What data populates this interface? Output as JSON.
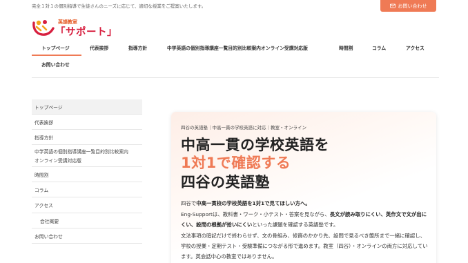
{
  "topbar": {
    "tagline": "完全１対１の個別指導で生徒さんのニーズに応じて、適切な授業をご提案いたします。",
    "contact_button": "お問い合わせ",
    "contact_icon": "mail-icon"
  },
  "logo": {
    "sub": "英語教室",
    "main": "「サポート」",
    "colors": {
      "orange": "#f4a31c",
      "red": "#d71f3f"
    }
  },
  "nav": {
    "items": [
      "トップページ",
      "代表挨拶",
      "指導方針",
      "中学英語の個別指導講座一覧目的別比較案内オンライン受講対応版",
      "時間割",
      "コラム",
      "アクセス",
      "お問い合わせ"
    ],
    "active_index": 0
  },
  "sidebar": {
    "items": [
      {
        "label": "トップページ",
        "active": true,
        "sub": false
      },
      {
        "label": "代表挨拶",
        "active": false,
        "sub": false
      },
      {
        "label": "指導方針",
        "active": false,
        "sub": false
      },
      {
        "label": "中学英語の個別指導講座一覧目的別比較案内",
        "label2": "オンライン受講対応版",
        "active": false,
        "sub": false
      },
      {
        "label": "時間割",
        "active": false,
        "sub": false
      },
      {
        "label": "コラム",
        "active": false,
        "sub": false
      },
      {
        "label": "アクセス",
        "active": false,
        "sub": false
      },
      {
        "label": "会社概要",
        "active": false,
        "sub": true
      },
      {
        "label": "お問い合わせ",
        "active": false,
        "sub": false
      }
    ]
  },
  "hero": {
    "tagline": "四谷の英語塾｜中高一貫の学校英語に対応｜教室・オンライン",
    "heading1": "中高一貫の学校英語を",
    "heading2": "1対1で確認する",
    "heading3": "四谷の英語塾",
    "p1_a": "四谷で",
    "p1_b": "中高一貫校の学校英語を1対1で見てほしい方へ。",
    "p2_a": "Eng-Supportは、教科書・ワーク・小テスト・答案を見ながら、",
    "p2_b": "長文が読み取りにくい、英作文で文が出にくい、設問の根拠が拾いにくい",
    "p2_c": "といった課題を確認する英語塾です。",
    "p3": "文法事項の暗記だけで終わらせず、文の骨組み、修飾のかかり先、設問で見るべき箇所まで一緒に確認し、学校の授業・定期テスト・受験準備につながる形で進めます。教室（四谷）・オンラインの両方に対応しています。英会話中心の教室ではありません。",
    "accent_color": "#ef7a55"
  }
}
